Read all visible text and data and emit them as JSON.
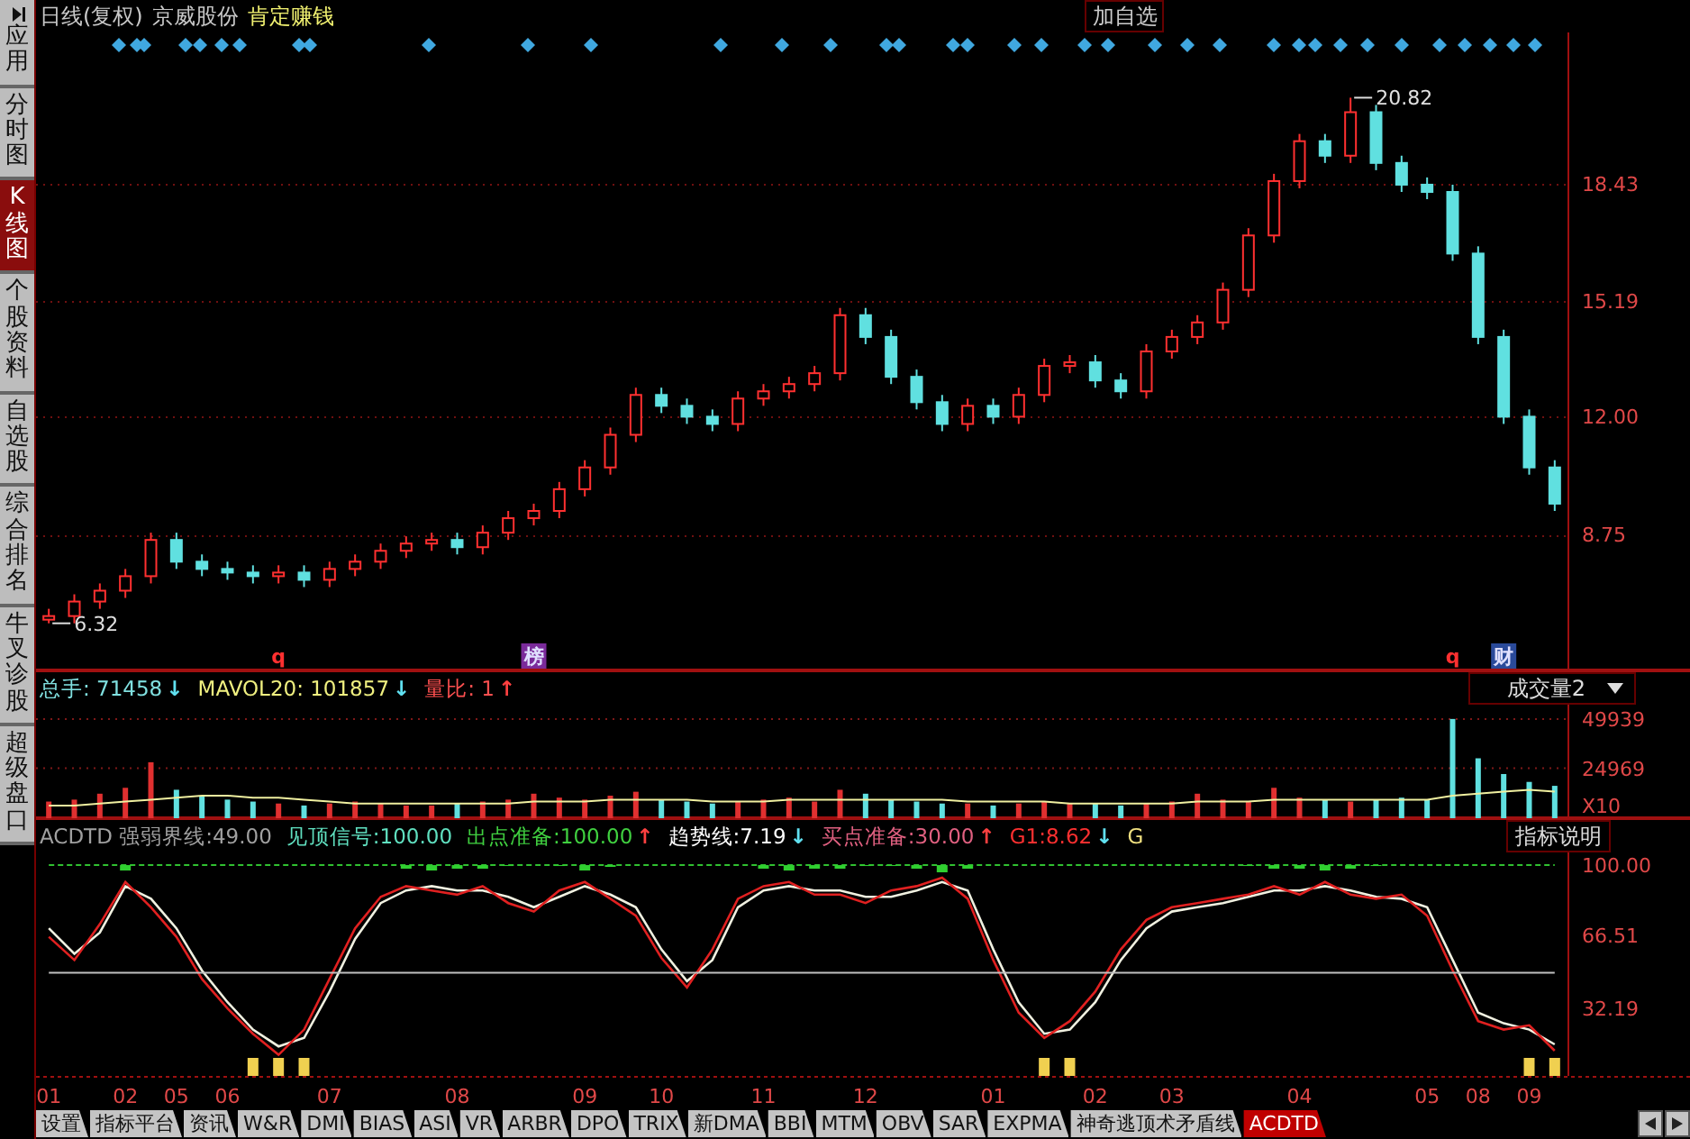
{
  "sidebar": {
    "items": [
      {
        "label": "应用",
        "kind": "app",
        "selected": false
      },
      {
        "label": "分时图",
        "kind": "plain",
        "selected": false
      },
      {
        "label": "K线图",
        "kind": "plain",
        "selected": true
      },
      {
        "label": "个股资料",
        "kind": "plain",
        "selected": false
      },
      {
        "label": "自选股",
        "kind": "plain",
        "selected": false
      },
      {
        "label": "综合排名",
        "kind": "plain",
        "selected": false
      },
      {
        "label": "牛叉诊股",
        "kind": "plain",
        "selected": false
      },
      {
        "label": "超级盘口",
        "kind": "plain",
        "selected": false
      }
    ]
  },
  "title_bar": {
    "period": "日线(复权)",
    "stock": "京威股份",
    "formula": "肯定赚钱",
    "button": "加自选"
  },
  "price_panel": {
    "chart_data": {
      "type": "candlestick",
      "ylim": [
        5.0,
        22.6
      ],
      "grid": true,
      "yticks": [
        {
          "value": 8.75,
          "label": "8.75"
        },
        {
          "value": 12.0,
          "label": "12.00"
        },
        {
          "value": 15.19,
          "label": "15.19"
        },
        {
          "value": 18.43,
          "label": "18.43"
        }
      ],
      "ohlc": [
        [
          6.4,
          6.7,
          6.3,
          6.5
        ],
        [
          6.5,
          7.1,
          6.3,
          6.9
        ],
        [
          6.9,
          7.4,
          6.7,
          7.2
        ],
        [
          7.2,
          7.8,
          7.0,
          7.6
        ],
        [
          7.6,
          8.8,
          7.4,
          8.6
        ],
        [
          8.6,
          8.8,
          7.8,
          8.0
        ],
        [
          8.0,
          8.2,
          7.6,
          7.8
        ],
        [
          7.8,
          8.0,
          7.5,
          7.7
        ],
        [
          7.7,
          7.9,
          7.4,
          7.6
        ],
        [
          7.6,
          7.9,
          7.4,
          7.7
        ],
        [
          7.7,
          7.9,
          7.3,
          7.5
        ],
        [
          7.5,
          8.0,
          7.3,
          7.8
        ],
        [
          7.8,
          8.2,
          7.6,
          8.0
        ],
        [
          8.0,
          8.5,
          7.8,
          8.3
        ],
        [
          8.3,
          8.7,
          8.1,
          8.5
        ],
        [
          8.5,
          8.8,
          8.3,
          8.6
        ],
        [
          8.6,
          8.8,
          8.2,
          8.4
        ],
        [
          8.4,
          9.0,
          8.2,
          8.8
        ],
        [
          8.8,
          9.4,
          8.6,
          9.2
        ],
        [
          9.2,
          9.6,
          9.0,
          9.4
        ],
        [
          9.4,
          10.2,
          9.2,
          10.0
        ],
        [
          10.0,
          10.8,
          9.8,
          10.6
        ],
        [
          10.6,
          11.7,
          10.4,
          11.5
        ],
        [
          11.5,
          12.8,
          11.3,
          12.6
        ],
        [
          12.6,
          12.8,
          12.1,
          12.3
        ],
        [
          12.3,
          12.5,
          11.8,
          12.0
        ],
        [
          12.0,
          12.2,
          11.6,
          11.8
        ],
        [
          11.8,
          12.7,
          11.6,
          12.5
        ],
        [
          12.5,
          12.9,
          12.3,
          12.7
        ],
        [
          12.7,
          13.1,
          12.5,
          12.9
        ],
        [
          12.9,
          13.4,
          12.7,
          13.2
        ],
        [
          13.2,
          15.0,
          13.0,
          14.8
        ],
        [
          14.8,
          15.0,
          14.0,
          14.2
        ],
        [
          14.2,
          14.4,
          12.9,
          13.1
        ],
        [
          13.1,
          13.3,
          12.2,
          12.4
        ],
        [
          12.4,
          12.6,
          11.6,
          11.8
        ],
        [
          11.8,
          12.5,
          11.6,
          12.3
        ],
        [
          12.3,
          12.5,
          11.8,
          12.0
        ],
        [
          12.0,
          12.8,
          11.8,
          12.6
        ],
        [
          12.6,
          13.6,
          12.4,
          13.4
        ],
        [
          13.4,
          13.7,
          13.2,
          13.5
        ],
        [
          13.5,
          13.7,
          12.8,
          13.0
        ],
        [
          13.0,
          13.2,
          12.5,
          12.7
        ],
        [
          12.7,
          14.0,
          12.5,
          13.8
        ],
        [
          13.8,
          14.4,
          13.6,
          14.2
        ],
        [
          14.2,
          14.8,
          14.0,
          14.6
        ],
        [
          14.6,
          15.7,
          14.4,
          15.5
        ],
        [
          15.5,
          17.2,
          15.3,
          17.0
        ],
        [
          17.0,
          18.7,
          16.8,
          18.5
        ],
        [
          18.5,
          19.8,
          18.3,
          19.6
        ],
        [
          19.6,
          19.8,
          19.0,
          19.2
        ],
        [
          19.2,
          20.8,
          19.0,
          20.4
        ],
        [
          20.4,
          20.6,
          18.8,
          19.0
        ],
        [
          19.0,
          19.2,
          18.2,
          18.4
        ],
        [
          18.4,
          18.6,
          18.0,
          18.2
        ],
        [
          18.2,
          18.4,
          16.3,
          16.5
        ],
        [
          16.5,
          16.7,
          14.0,
          14.2
        ],
        [
          14.2,
          14.4,
          11.8,
          12.0
        ],
        [
          12.0,
          12.2,
          10.4,
          10.6
        ],
        [
          10.6,
          10.8,
          9.4,
          9.6
        ]
      ],
      "annotations": [
        "20.82",
        "6.32"
      ]
    },
    "event_markers": [
      {
        "text": "q",
        "kind": "plain",
        "color": "#ff3030"
      },
      {
        "text": "榜",
        "kind": "boxed",
        "color": "#7a2a9a"
      },
      {
        "text": "q",
        "kind": "plain",
        "color": "#ff3030"
      },
      {
        "text": "财",
        "kind": "boxed",
        "color": "#2a4a9a"
      }
    ]
  },
  "volume_panel": {
    "header": [
      {
        "label": "总手:",
        "value": "71458",
        "arrow": {
          "text": "↓",
          "color": "#60e0f0"
        },
        "color": "#80e0e0"
      },
      {
        "label": "MAVOL20:",
        "value": "101857",
        "arrow": {
          "text": "↓",
          "color": "#60e0f0"
        },
        "color": "#f0f080"
      },
      {
        "label": "量比:",
        "value": "1",
        "arrow": {
          "text": "↑",
          "color": "#ff4040"
        },
        "color": "#ff5050"
      }
    ],
    "dropdown": "成交量2",
    "unit": "X10",
    "chart_data": {
      "type": "bar",
      "ylim": [
        0,
        57270
      ],
      "yticks": [
        24969,
        49939
      ],
      "grid": true,
      "series": [
        {
          "color": "#e03030",
          "values": [
            8000,
            9000,
            12000,
            15000,
            28000,
            null,
            null,
            null,
            null,
            7000,
            null,
            7000,
            8000,
            7000,
            6000,
            6000,
            null,
            8000,
            9000,
            12000,
            10000,
            9000,
            11000,
            13000,
            null,
            null,
            null,
            8000,
            9000,
            10000,
            8000,
            14000,
            null,
            null,
            null,
            null,
            7000,
            null,
            7000,
            8000,
            7000,
            null,
            null,
            7000,
            8000,
            12000,
            9000,
            8000,
            15000,
            10000,
            null,
            8000,
            null,
            null,
            null,
            null,
            null,
            null,
            null,
            null
          ]
        },
        {
          "color": "#60e0e0",
          "values": [
            null,
            null,
            null,
            null,
            null,
            14000,
            11000,
            9000,
            8000,
            null,
            6000,
            null,
            null,
            null,
            null,
            null,
            7000,
            null,
            null,
            null,
            null,
            null,
            null,
            null,
            9000,
            8000,
            7000,
            null,
            null,
            null,
            null,
            null,
            12000,
            9000,
            8000,
            7000,
            null,
            6000,
            null,
            null,
            null,
            7000,
            6000,
            null,
            null,
            null,
            null,
            null,
            null,
            null,
            9000,
            null,
            9000,
            10000,
            9000,
            50000,
            30000,
            22000,
            18000,
            16000
          ]
        },
        {
          "type": "line",
          "color": "#f0f0a0",
          "values": [
            6000,
            6000,
            7000,
            8000,
            9000,
            10000,
            11000,
            11000,
            10000,
            10000,
            9000,
            8000,
            7000,
            7000,
            7000,
            7000,
            7000,
            7000,
            7000,
            8000,
            8000,
            8000,
            9000,
            9000,
            9000,
            9000,
            8000,
            8000,
            8000,
            9000,
            9000,
            9000,
            9000,
            9000,
            9000,
            9000,
            8000,
            8000,
            8000,
            8000,
            7000,
            7000,
            7000,
            7000,
            7000,
            8000,
            8000,
            8000,
            9000,
            9000,
            9000,
            9000,
            9000,
            9000,
            9000,
            11000,
            12000,
            13000,
            14000,
            13000
          ]
        }
      ]
    }
  },
  "indicator_panel": {
    "header": [
      {
        "label": "ACDTD 强弱界线:",
        "value": "49.00",
        "color": "#a0a0a0"
      },
      {
        "label": "见顶信号:",
        "value": "100.00",
        "color": "#60e0c0"
      },
      {
        "label": "出点准备:",
        "value": "100.00",
        "arrow": {
          "text": "↑",
          "color": "#ff4040"
        },
        "color": "#40d040"
      },
      {
        "label": "趋势线:",
        "value": "7.19",
        "arrow": {
          "text": "↓",
          "color": "#60e0f0"
        },
        "color": "#ffffff"
      },
      {
        "label": "买点准备:",
        "value": "30.00",
        "arrow": {
          "text": "↑",
          "color": "#ff4040"
        },
        "color": "#e06080"
      },
      {
        "label": "G1:",
        "value": "8.62",
        "arrow": {
          "text": "↓",
          "color": "#60e0f0"
        },
        "color": "#ff3030"
      },
      {
        "label": "G",
        "color": "#f0e080"
      }
    ],
    "button": "指标说明",
    "chart_data": {
      "type": "line",
      "ylim": [
        0,
        106
      ],
      "yticks": [
        {
          "value": 32.19,
          "label": "32.19"
        },
        {
          "value": 66.51,
          "label": "66.51"
        },
        {
          "value": 100,
          "label": "100.00"
        }
      ],
      "series": [
        {
          "color": "#f0f0e0",
          "values": [
            70,
            58,
            68,
            90,
            84,
            70,
            50,
            35,
            22,
            14,
            18,
            40,
            65,
            82,
            88,
            90,
            88,
            88,
            85,
            80,
            85,
            90,
            86,
            80,
            60,
            45,
            55,
            80,
            88,
            90,
            88,
            88,
            85,
            85,
            88,
            92,
            88,
            60,
            35,
            20,
            22,
            35,
            55,
            70,
            78,
            80,
            82,
            85,
            88,
            88,
            90,
            88,
            85,
            84,
            80,
            55,
            30,
            25,
            22,
            15
          ]
        },
        {
          "color": "#e02020",
          "values": [
            66,
            55,
            72,
            92,
            80,
            66,
            46,
            32,
            20,
            10,
            22,
            46,
            70,
            85,
            90,
            88,
            86,
            90,
            82,
            78,
            88,
            92,
            84,
            76,
            56,
            42,
            60,
            84,
            90,
            92,
            86,
            86,
            82,
            88,
            90,
            94,
            84,
            55,
            30,
            18,
            26,
            40,
            60,
            74,
            80,
            82,
            84,
            86,
            90,
            86,
            92,
            86,
            84,
            86,
            76,
            50,
            26,
            22,
            24,
            12
          ]
        },
        {
          "color": "#30c030",
          "line_style": "dashed",
          "values": [
            100,
            100,
            100,
            100,
            100,
            100,
            100,
            100,
            100,
            100,
            100,
            100,
            100,
            100,
            100,
            100,
            100,
            100,
            100,
            100,
            100,
            100,
            100,
            100,
            100,
            100,
            100,
            100,
            100,
            100,
            100,
            100,
            100,
            100,
            100,
            100,
            100,
            100,
            100,
            100,
            100,
            100,
            100,
            100,
            100,
            100,
            100,
            100,
            100,
            100,
            100,
            100,
            100,
            100,
            100,
            100,
            100,
            100,
            100,
            100
          ]
        },
        {
          "color": "#c0c0c0",
          "values": [
            49,
            49,
            49,
            49,
            49,
            49,
            49,
            49,
            49,
            49,
            49,
            49,
            49,
            49,
            49,
            49,
            49,
            49,
            49,
            49,
            49,
            49,
            49,
            49,
            49,
            49,
            49,
            49,
            49,
            49,
            49,
            49,
            49,
            49,
            49,
            49,
            49,
            49,
            49,
            49,
            49,
            49,
            49,
            49,
            49,
            49,
            49,
            49,
            49,
            49,
            49,
            49,
            49,
            49,
            49,
            49,
            49,
            49,
            49,
            49
          ]
        }
      ]
    },
    "month_labels": [
      "01",
      "02",
      "05",
      "06",
      "07",
      "08",
      "09",
      "10",
      "11",
      "12",
      "01",
      "02",
      "03",
      "04",
      "05",
      "08",
      "09"
    ]
  },
  "tabs": [
    {
      "label": "设置",
      "selected": false
    },
    {
      "label": "指标平台",
      "selected": false
    },
    {
      "label": "资讯",
      "selected": false
    },
    {
      "label": "W&R",
      "selected": false
    },
    {
      "label": "DMI",
      "selected": false
    },
    {
      "label": "BIAS",
      "selected": false
    },
    {
      "label": "ASI",
      "selected": false
    },
    {
      "label": "VR",
      "selected": false
    },
    {
      "label": "ARBR",
      "selected": false
    },
    {
      "label": "DPO",
      "selected": false
    },
    {
      "label": "TRIX",
      "selected": false
    },
    {
      "label": "新DMA",
      "selected": false
    },
    {
      "label": "BBI",
      "selected": false
    },
    {
      "label": "MTM",
      "selected": false
    },
    {
      "label": "OBV",
      "selected": false
    },
    {
      "label": "SAR",
      "selected": false
    },
    {
      "label": "EXPMA",
      "selected": false
    },
    {
      "label": "神奇逃顶术矛盾线",
      "selected": false
    },
    {
      "label": "ACDTD",
      "selected": true
    }
  ]
}
